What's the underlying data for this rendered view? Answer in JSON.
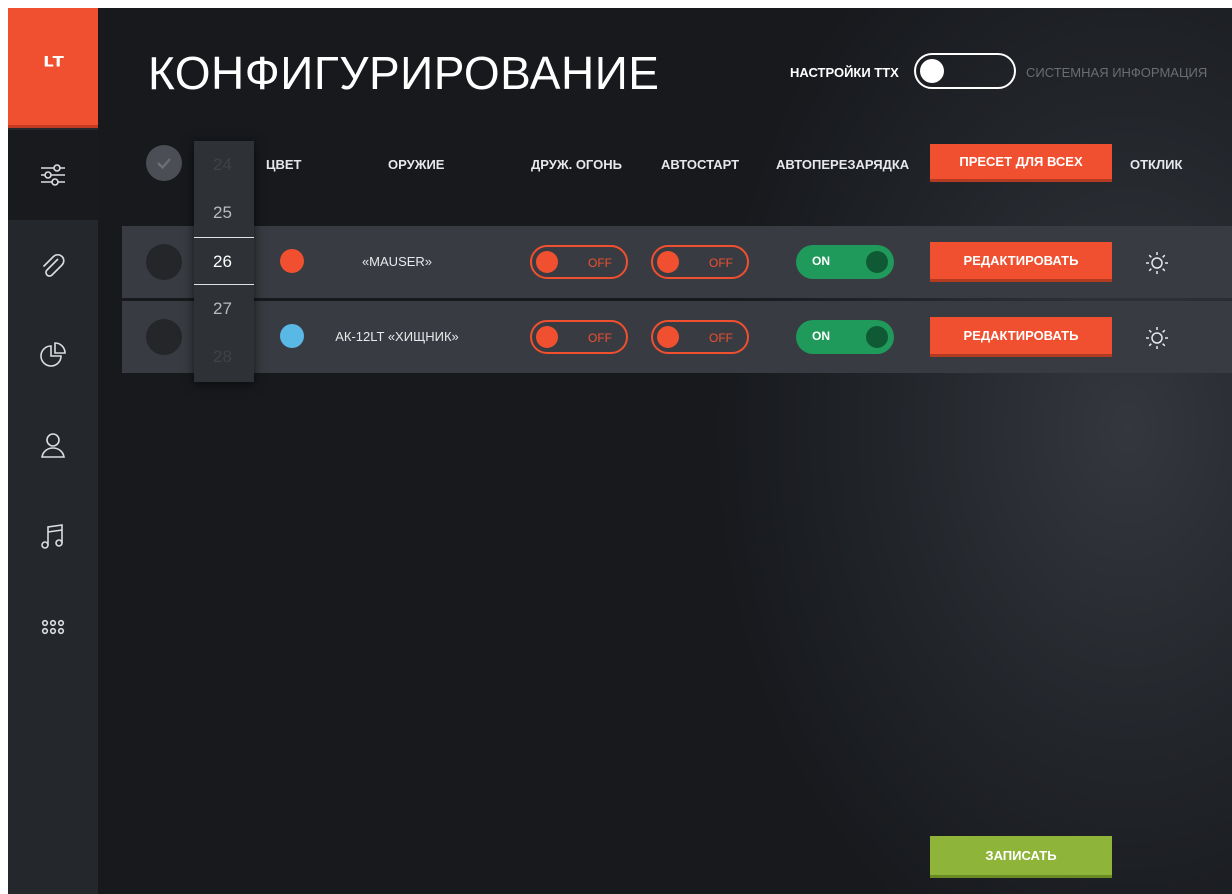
{
  "app": {
    "logo_text": "ᴸᵀ"
  },
  "sidebar": {
    "items": [
      {
        "name": "settings-sliders",
        "icon": "sliders-icon",
        "active": true
      },
      {
        "name": "attachments",
        "icon": "paperclip-icon"
      },
      {
        "name": "statistics",
        "icon": "pie-chart-icon"
      },
      {
        "name": "profile",
        "icon": "user-icon"
      },
      {
        "name": "music",
        "icon": "music-note-icon"
      },
      {
        "name": "more",
        "icon": "grid-dots-icon"
      }
    ]
  },
  "header": {
    "title": "КОНФИГУРИРОВАНИЕ",
    "ttx_label": "НАСТРОЙКИ ТТХ",
    "sys_label": "СИСТЕМНАЯ ИНФОРМАЦИЯ"
  },
  "table": {
    "columns": {
      "color": "ЦВЕТ",
      "weapon": "ОРУЖИЕ",
      "friendly_fire": "ДРУЖ. ОГОНЬ",
      "autostart": "АВТОСТАРТ",
      "autoreload": "АВТОПЕРЕЗАРЯДКА",
      "preset": "ПРЕСЕТ ДЛЯ ВСЕХ",
      "response": "ОТКЛИК"
    },
    "rows": [
      {
        "color": "#f0502f",
        "weapon": "«MAUSER»",
        "friendly_fire": "OFF",
        "autostart": "OFF",
        "autoreload": "ON",
        "edit_label": "РЕДАКТИРОВАТЬ"
      },
      {
        "color": "#5ab8e6",
        "weapon": "АК-12LT «ХИЩНИК»",
        "friendly_fire": "OFF",
        "autostart": "OFF",
        "autoreload": "ON",
        "edit_label": "РЕДАКТИРОВАТЬ"
      }
    ]
  },
  "picker": {
    "values": [
      "24",
      "25",
      "26",
      "27",
      "28"
    ],
    "selected": "26"
  },
  "footer": {
    "save_label": "ЗАПИСАТЬ"
  },
  "colors": {
    "accent": "#f0502f",
    "on": "#1f9a5b",
    "save": "#8fb43a"
  }
}
